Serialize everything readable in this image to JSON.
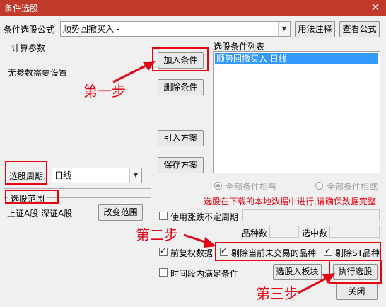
{
  "window": {
    "title": "条件选股",
    "close_glyph": "×"
  },
  "formula": {
    "label": "条件选股公式",
    "value": "顺势回撤买入 -",
    "usage_button": "用法注释",
    "view_button": "查看公式"
  },
  "params": {
    "group_label": "计算参数",
    "no_params_text": "无参数需要设置"
  },
  "period": {
    "label": "选股周期:",
    "value": "日线"
  },
  "range": {
    "group_label": "选股范围",
    "text": "上证A股 深证A股",
    "change_button": "改变范围"
  },
  "actions": {
    "add_condition": "加入条件",
    "delete_condition": "删除条件",
    "import_scheme": "引入方案",
    "save_scheme": "保存方案"
  },
  "condition_list": {
    "label": "选股条件列表",
    "items": [
      "顺势回撤买入  日线"
    ]
  },
  "logic": {
    "all_and": "全部条件相与",
    "all_or": "全部条件相或"
  },
  "notice": "选股在下载的本地数据中进行,请确保数据完整",
  "options": {
    "variable_period": "使用涨跌不定周期",
    "stock_count_label": "品种数",
    "selected_count_label": "选中数",
    "prior_adjust": "前复权数据",
    "exclude_untraded": "剔除当前未交易的品种",
    "exclude_st": "剔除ST品种",
    "period_satisfy": "时间段内满足条件"
  },
  "bottom": {
    "to_block": "选股入板块",
    "execute": "执行选股",
    "close": "关闭"
  },
  "annotations": {
    "step1": "第一步",
    "step2": "第二步",
    "step3": "第三步"
  },
  "colors": {
    "title_bar": "#c0392b",
    "annotation_red": "#e60012",
    "selection_blue": "#3399ff"
  }
}
